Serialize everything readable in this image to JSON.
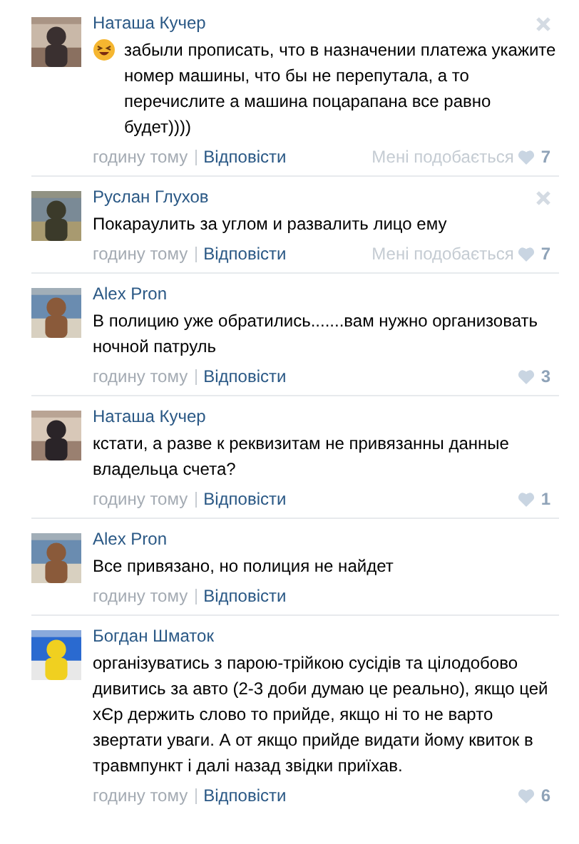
{
  "comments": [
    {
      "author": "Наташа Кучер",
      "emoji": true,
      "text": "забыли прописать, что в назначении платежа укажите номер машины, что бы не перепутала, а то перечислите а машина поцарапана все равно будет))))",
      "time": "годину тому",
      "reply": "Відповісти",
      "like_label": "Мені подобається",
      "likes": "7",
      "show_close": true
    },
    {
      "author": "Руслан Глухов",
      "emoji": false,
      "text": "Покараулить за углом и развалить лицо ему",
      "time": "годину тому",
      "reply": "Відповісти",
      "like_label": "Мені подобається",
      "likes": "7",
      "show_close": true
    },
    {
      "author": "Alex Pron",
      "emoji": false,
      "text": "В полицию уже обратились.......вам нужно организовать ночной патруль",
      "time": "годину тому",
      "reply": "Відповісти",
      "likes": "3",
      "show_close": false
    },
    {
      "author": "Наташа Кучер",
      "emoji": false,
      "text": "кстати, а разве к реквизитам не привязанны данные владельца счета?",
      "time": "годину тому",
      "reply": "Відповісти",
      "likes": "1",
      "show_close": false
    },
    {
      "author": "Alex Pron",
      "emoji": false,
      "text": "Все привязано, но полиция не найдет",
      "time": "годину тому",
      "reply": "Відповісти",
      "show_close": false
    },
    {
      "author": "Богдан Шматок",
      "emoji": false,
      "text": "організуватись з парою-трійкою сусідів та цілодобово дивитись за авто (2-3 доби думаю це реально), якщо цей хЄр держить слово то прийде, якщо ні то не варто звертати уваги. А от якщо прийде видати йому квиток в травмпункт і далі назад звідки приїхав.",
      "time": "годину тому",
      "reply": "Відповісти",
      "likes": "6",
      "show_close": false
    }
  ]
}
